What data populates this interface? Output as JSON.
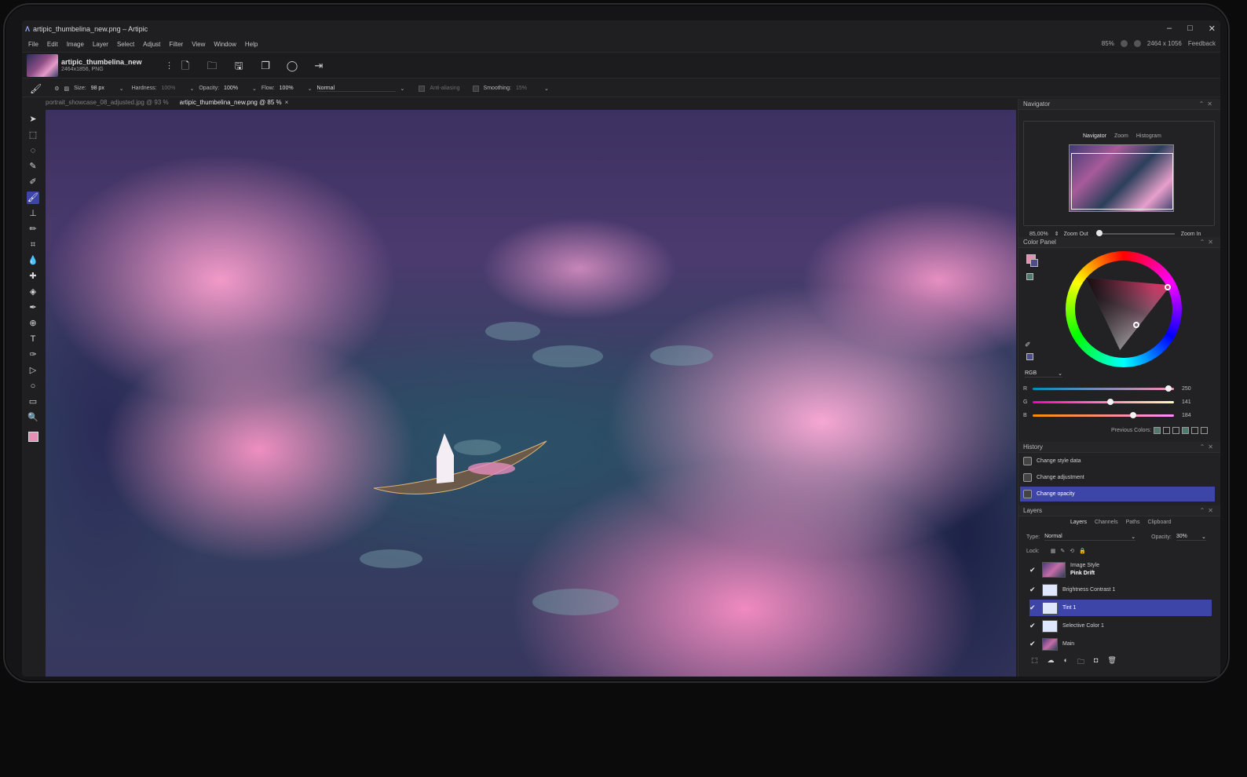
{
  "window": {
    "title": "artipic_thumbelina_new.png – Artipic",
    "menu": [
      "File",
      "Edit",
      "Image",
      "Layer",
      "Select",
      "Adjust",
      "Filter",
      "View",
      "Window",
      "Help"
    ],
    "zoom": "85%",
    "dimensions": "2464 x 1056",
    "feedback": "Feedback",
    "controls": [
      "–",
      "□",
      "✕"
    ]
  },
  "document": {
    "name": "artipic_thumbelina_new",
    "meta": "2464x1856, PNG",
    "more": "⋮",
    "icons": [
      "new-file-icon",
      "open-folder-icon",
      "save-icon",
      "window-icon",
      "ellipse-icon",
      "export-icon"
    ]
  },
  "options": {
    "size_label": "Size:",
    "size": "98 px",
    "hardness_label": "Hardness:",
    "hardness": "100%",
    "opacity_label": "Opacity:",
    "opacity": "100%",
    "flow_label": "Flow:",
    "flow": "100%",
    "blend": "Normal",
    "antialias_label": "Anti-aliasing",
    "smoothing_label": "Smoothing:",
    "smoothing": "15%"
  },
  "tabs": [
    {
      "label": "portrait_showcase_08_adjusted.jpg @ 93 %"
    },
    {
      "label": "artipic_thumbelina_new.png @ 85 %",
      "close": "×"
    }
  ],
  "tools": [
    "arrow-tool",
    "marquee-tool",
    "lasso-tool",
    "quick-select-tool",
    "eyedropper-tool",
    "brush-tool",
    "stamp-tool",
    "eraser-tool",
    "crop-tool",
    "blur-tool",
    "heal-tool",
    "bucket-tool",
    "dodge-tool",
    "zoom-tool",
    "text-tool",
    "pen-tool",
    "path-select-tool",
    "shape-tool",
    "gradient-tool",
    "magnifier-tool"
  ],
  "tool_glyphs": [
    "➤",
    "⬚",
    "◌",
    "✎",
    "✐",
    "🖌",
    "⊥",
    "✏",
    "⌗",
    "💧",
    "✚",
    "◈",
    "✒",
    "⊕",
    "T",
    "✑",
    "▷",
    "○",
    "▭",
    "🔍"
  ],
  "navigator": {
    "title": "Navigator",
    "tabs": [
      "Navigator",
      "Zoom",
      "Histogram"
    ],
    "zoom_value": "85,00%",
    "zoom_out": "Zoom Out",
    "zoom_in": "Zoom In",
    "zoom_fraction": 0.0
  },
  "color_panel": {
    "title": "Color Panel",
    "mode": "RGB",
    "r_label": "R",
    "g_label": "G",
    "b_label": "B",
    "r": "250",
    "g": "141",
    "b": "184",
    "previous_label": "Previous Colors:",
    "previous_colors": [
      "#4e7a6e",
      "#222222",
      "#222222",
      "#4e7a6e",
      "#222222",
      "#222222"
    ],
    "fg_color": "#e58eb6",
    "accent": "#3d45a8"
  },
  "history": {
    "title": "History",
    "items": [
      "Change style data",
      "Change adjustment",
      "Change opacity"
    ],
    "selected": 2
  },
  "layers": {
    "title": "Layers",
    "tabs": [
      "Layers",
      "Channels",
      "Paths",
      "Clipboard"
    ],
    "type_label": "Type:",
    "type": "Normal",
    "opacity_label": "Opacity:",
    "opacity": "30%",
    "lock_label": "Lock:",
    "items": [
      {
        "name": "Image Style",
        "sub": "Pink Drift"
      },
      {
        "name": "Brightness Contrast  1"
      },
      {
        "name": "Tint  1"
      },
      {
        "name": "Selective Color  1"
      },
      {
        "name": "Main"
      }
    ],
    "selected": 2
  }
}
